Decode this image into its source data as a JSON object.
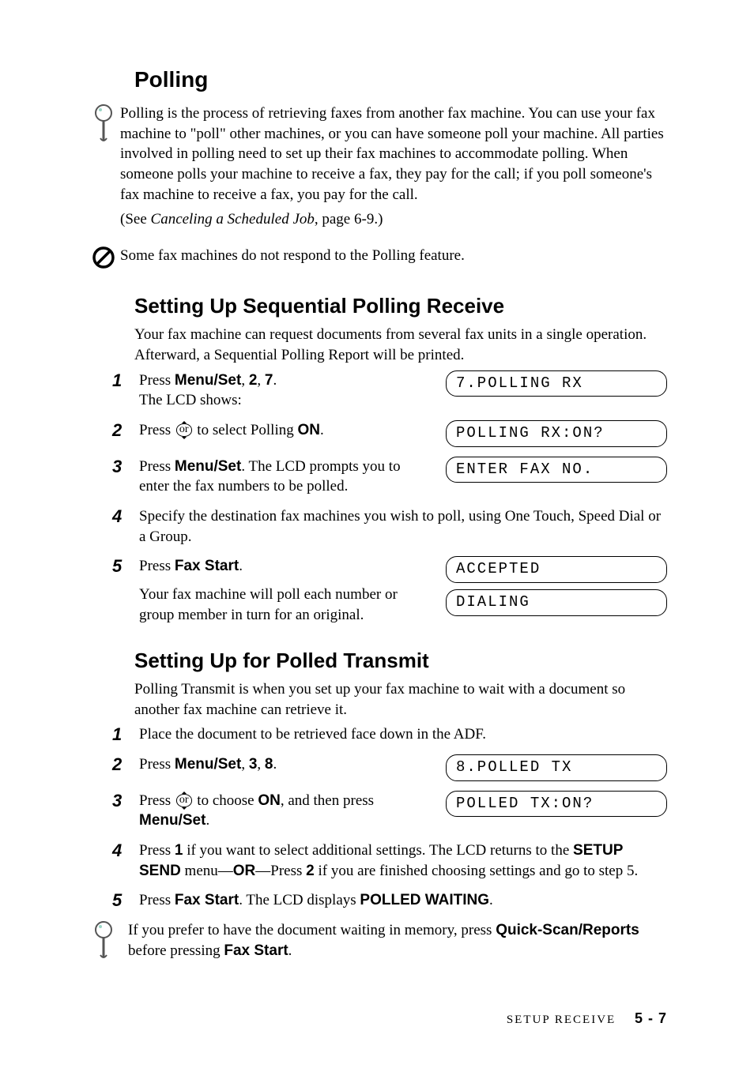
{
  "s1": {
    "title": "Polling",
    "intro": "Polling is the process of retrieving faxes from another fax machine.  You can use your fax machine to \"poll\" other machines, or you can have someone poll your machine.  All parties involved in polling need to set up their fax machines to accommodate polling.  When someone polls your machine to receive a fax, they pay for the call; if you poll someone's fax machine to receive a fax, you pay for the call.",
    "see_prefix": "(See ",
    "see_link": "Canceling a Scheduled Job",
    "see_suffix": ", page 6-9.)",
    "note": "Some fax machines do not respond to the Polling feature."
  },
  "s2": {
    "title": "Setting Up Sequential Polling Receive",
    "intro": "Your fax machine can request documents from several fax units in a single operation. Afterward, a Sequential Polling Report will be printed.",
    "step1_a": "Press ",
    "step1_b": "Menu/Set",
    "step1_c": ", ",
    "step1_d": "2",
    "step1_e": ", ",
    "step1_f": "7",
    "step1_g": ".",
    "step1_line2": "The LCD shows:",
    "lcd1": "7.POLLING RX",
    "step2_a": "Press ",
    "step2_b": "  to select Polling ",
    "step2_c": "ON",
    "step2_d": ".",
    "lcd2": "POLLING RX:ON?",
    "step3_a": "Press ",
    "step3_b": "Menu/Set",
    "step3_c": ". The LCD prompts you to enter the fax numbers to be polled.",
    "lcd3": "ENTER FAX NO.",
    "step4": "Specify the destination fax machines you wish to poll, using One Touch, Speed Dial or a Group.",
    "step5_a": "Press ",
    "step5_b": "Fax Start",
    "step5_c": ".",
    "step5_body": "Your fax machine will poll each number or group member in turn for an original.",
    "lcd5a": "ACCEPTED",
    "lcd5b": "DIALING"
  },
  "s3": {
    "title": "Setting Up for Polled Transmit",
    "intro": "Polling Transmit is when you set up your fax machine to wait with a document so another fax machine can retrieve it.",
    "step1": "Place the document to be retrieved face down in the ADF.",
    "step2_a": "Press ",
    "step2_b": "Menu/Set",
    "step2_c": ", ",
    "step2_d": "3",
    "step2_e": ", ",
    "step2_f": "8",
    "step2_g": ".",
    "lcd2": "8.POLLED TX",
    "step3_a": "Press ",
    "step3_b": "  to choose ",
    "step3_c": "ON",
    "step3_d": ", and then press ",
    "step3_e": "Menu/Set",
    "step3_f": ".",
    "lcd3": "POLLED TX:ON?",
    "step4_a": "Press ",
    "step4_b": "1",
    "step4_c": " if you want to select additional settings. The LCD returns to the ",
    "step4_d": "SETUP SEND",
    "step4_e": " menu—",
    "step4_f": "OR",
    "step4_g": "—Press ",
    "step4_h": "2",
    "step4_i": " if you are finished choosing settings and go to step 5.",
    "step5_a": "Press ",
    "step5_b": "Fax Start",
    "step5_c": ". The LCD displays ",
    "step5_d": "POLLED WAITING",
    "step5_e": ".",
    "tip_a": "If you prefer to have the document waiting in memory, press ",
    "tip_b": "Quick-Scan/Reports",
    "tip_c": " before pressing ",
    "tip_d": "Fax Start",
    "tip_e": "."
  },
  "footer": {
    "section": "SETUP RECEIVE",
    "page": "5 - 7"
  },
  "or_label": "or"
}
